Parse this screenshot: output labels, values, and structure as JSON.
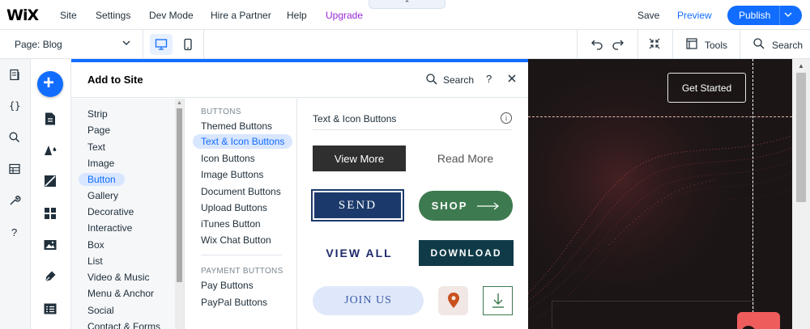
{
  "topbar": {
    "logo": "WiX",
    "menu": [
      "Site",
      "Settings",
      "Dev Mode",
      "Hire a Partner",
      "Help",
      "Upgrade"
    ],
    "collapse_glyph": "⌃",
    "save": "Save",
    "preview": "Preview",
    "publish": "Publish"
  },
  "subbar": {
    "page_label": "Page: Blog",
    "tools": "Tools",
    "search": "Search"
  },
  "panel": {
    "title": "Add to Site",
    "search": "Search",
    "help": "?",
    "categories": [
      "Strip",
      "Page",
      "Text",
      "Image",
      "Button",
      "Gallery",
      "Decorative",
      "Interactive",
      "Box",
      "List",
      "Video & Music",
      "Menu & Anchor",
      "Social",
      "Contact & Forms"
    ],
    "active_category": "Button",
    "buttons_heading": "BUTTONS",
    "button_types": [
      "Themed Buttons",
      "Text & Icon Buttons",
      "Icon Buttons",
      "Image Buttons",
      "Document Buttons",
      "Upload Buttons",
      "iTunes Button",
      "Wix Chat Button"
    ],
    "payment_heading": "PAYMENT BUTTONS",
    "payment_types": [
      "Pay Buttons",
      "PayPal Buttons"
    ],
    "section_title": "Text & Icon Buttons",
    "samples": {
      "view_more": "View More",
      "read_more": "Read More",
      "send": "SEND",
      "shop": "SHOP",
      "view_all": "VIEW ALL",
      "download": "DOWNLOAD",
      "join_us": "JOIN US"
    }
  },
  "canvas": {
    "get_started": "Get Started"
  },
  "colors": {
    "accent": "#116dff",
    "upgrade": "#9a27d5",
    "canvas_bg": "#1b1516"
  }
}
